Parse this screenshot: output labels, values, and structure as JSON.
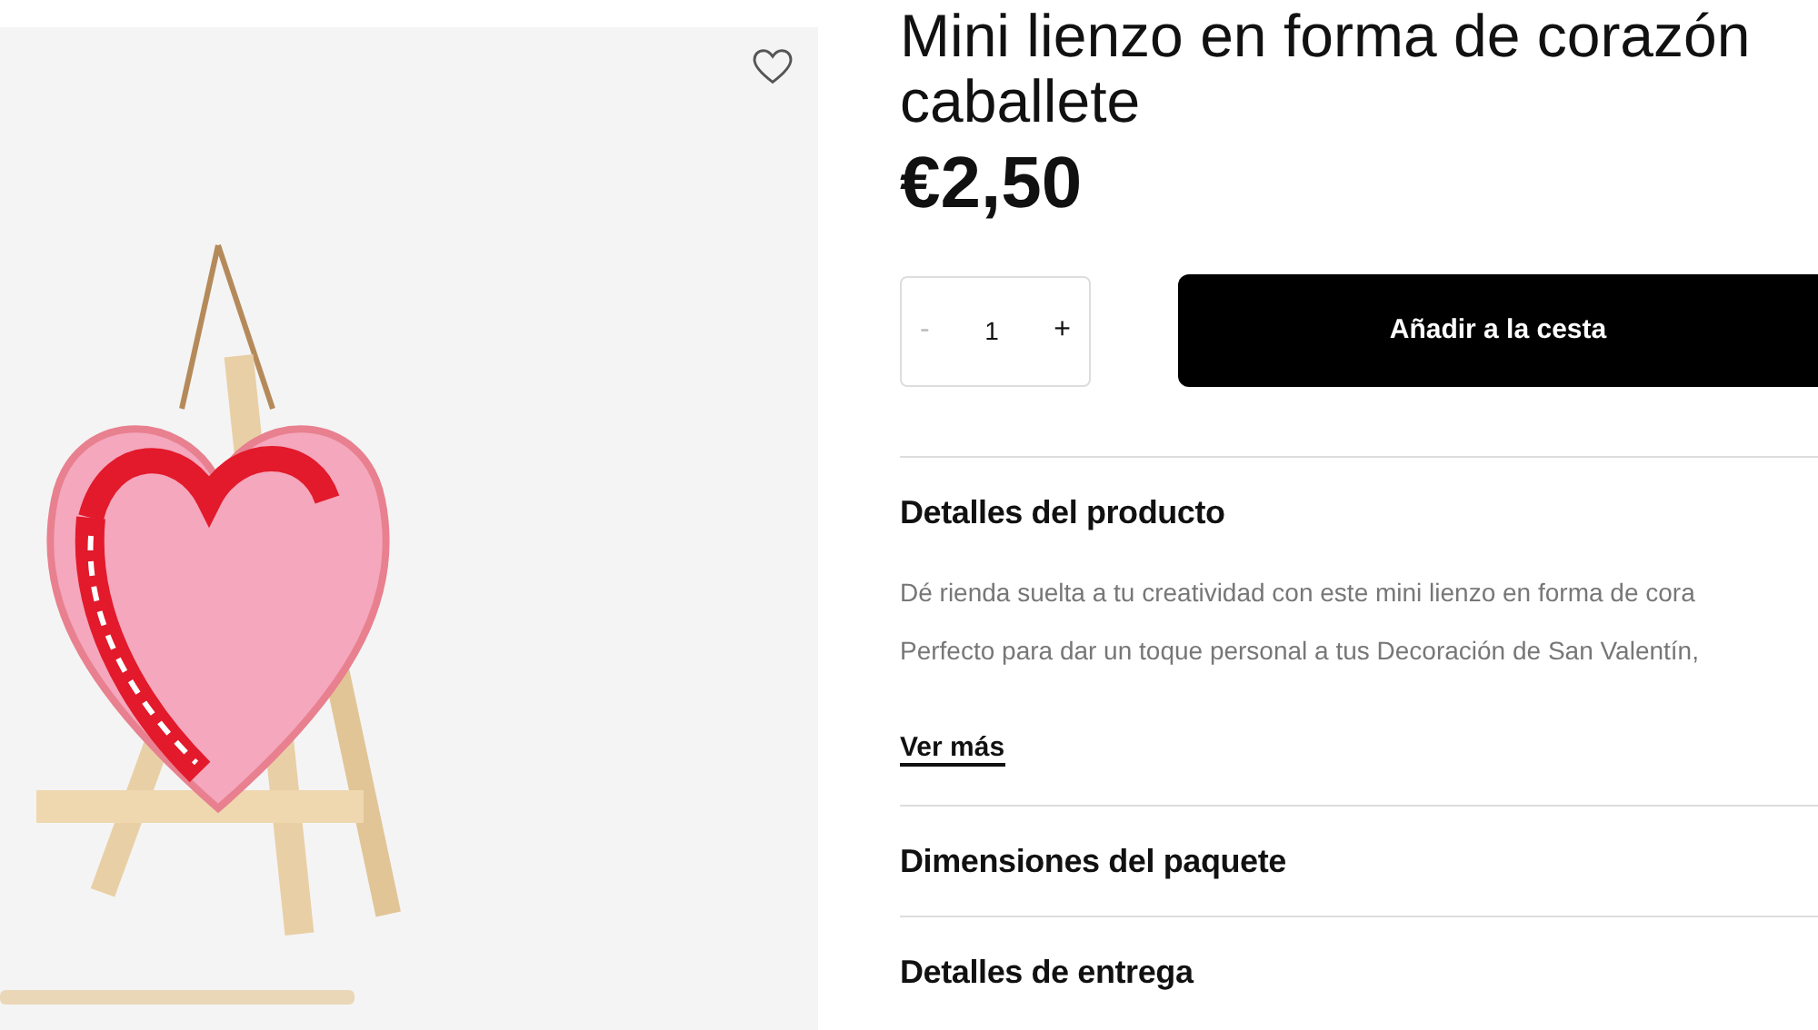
{
  "product": {
    "title": "Mini lienzo en forma de corazón caballete",
    "price": "€2,50",
    "favorite": false
  },
  "quantity": {
    "decrease": "-",
    "value": "1",
    "increase": "+",
    "decrease_disabled": true
  },
  "add_to_cart": "Añadir a la cesta",
  "sections": [
    {
      "title": "Detalles del producto",
      "lines": [
        "Dé rienda suelta a tu creatividad con este mini lienzo en forma de cora",
        "Perfecto para dar un toque personal a tus Decoración de San Valentín,"
      ],
      "more": "Ver más"
    },
    {
      "title": "Dimensiones del paquete"
    },
    {
      "title": "Detalles de entrega"
    }
  ]
}
